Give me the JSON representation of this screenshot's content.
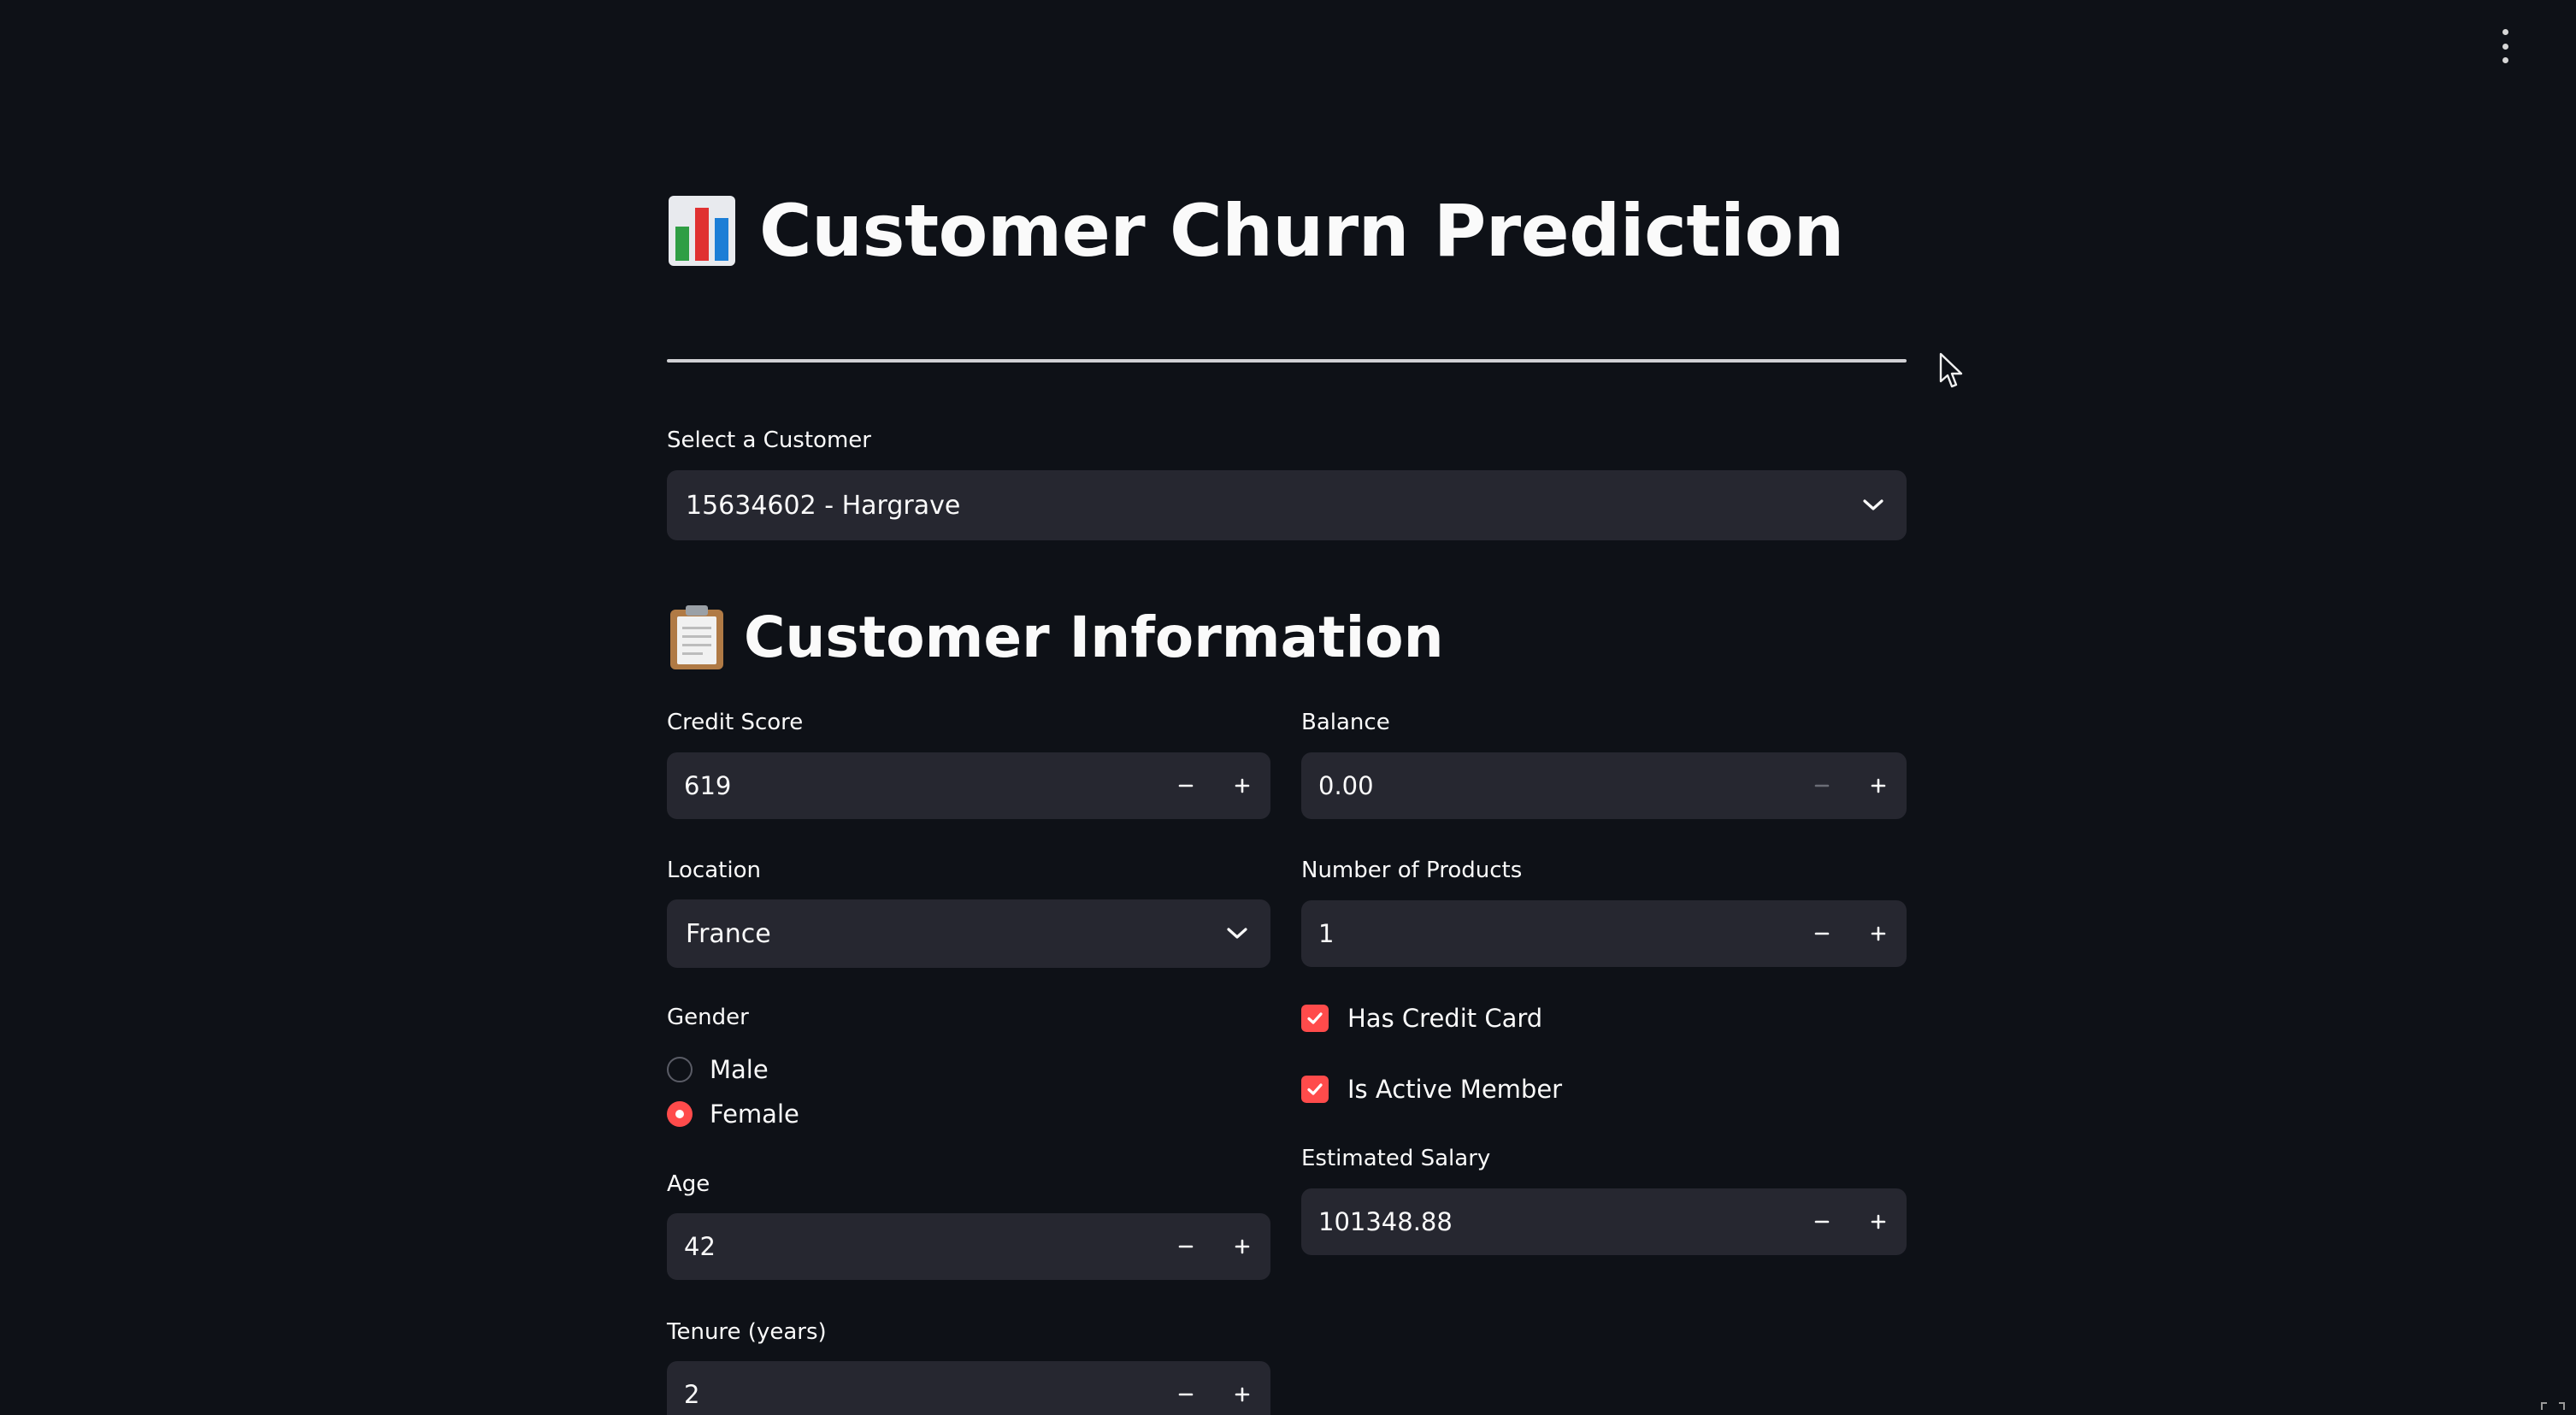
{
  "app": {
    "title": "Customer Churn Prediction",
    "title_icon": "bar-chart-emoji",
    "menu_icon": "kebab-menu-icon"
  },
  "customer_select": {
    "label": "Select a Customer",
    "value": "15634602 - Hargrave"
  },
  "section": {
    "title": "Customer Information",
    "icon": "clipboard-emoji"
  },
  "fields": {
    "credit_score": {
      "label": "Credit Score",
      "value": "619"
    },
    "balance": {
      "label": "Balance",
      "value": "0.00"
    },
    "location": {
      "label": "Location",
      "value": "France"
    },
    "num_products": {
      "label": "Number of Products",
      "value": "1"
    },
    "gender": {
      "label": "Gender",
      "options": [
        "Male",
        "Female"
      ],
      "selected": "Female"
    },
    "has_credit_card": {
      "label": "Has Credit Card",
      "checked": true
    },
    "is_active_member": {
      "label": "Is Active Member",
      "checked": true
    },
    "age": {
      "label": "Age",
      "value": "42"
    },
    "estimated_salary": {
      "label": "Estimated Salary",
      "value": "101348.88"
    },
    "tenure": {
      "label": "Tenure (years)",
      "value": "2"
    }
  },
  "colors": {
    "background": "#0e1117",
    "widget": "#262730",
    "accent": "#ff4b4b",
    "text": "#fafafa"
  }
}
